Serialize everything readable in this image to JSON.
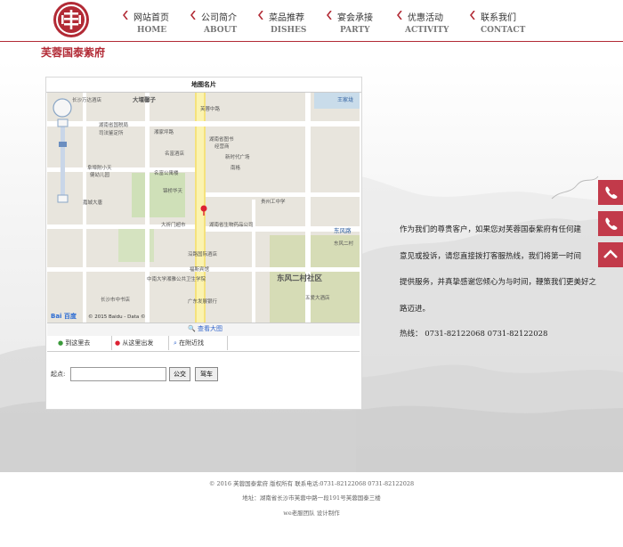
{
  "nav": {
    "items": [
      {
        "cn": "网站首页",
        "en": "HOME"
      },
      {
        "cn": "公司简介",
        "en": "ABOUT"
      },
      {
        "cn": "菜品推荐",
        "en": "DISHES"
      },
      {
        "cn": "宴会承接",
        "en": "PARTY"
      },
      {
        "cn": "优惠活动",
        "en": "ACTIVITY"
      },
      {
        "cn": "联系我们",
        "en": "CONTACT"
      }
    ]
  },
  "page": {
    "title": "芙蓉国泰紫府"
  },
  "map": {
    "header": "地图名片",
    "copyright": "© 2015 Baidu - Data ©",
    "big_map": "查看大图",
    "tabs": [
      "到这里去",
      "从这里出发",
      "在附近找"
    ],
    "start_label": "起点:",
    "bus_button": "公交",
    "drive_button": "驾车",
    "labels": {
      "l1": "长沙万达酒店",
      "l2": "湖南省国税局",
      "l3": "司法鉴定所",
      "l4": "湘家坪路",
      "l5": "名富酒店",
      "l6": "名富公寓楼",
      "l7": "新时代广场",
      "l8": "南格",
      "l9": "阜埠附小天",
      "l10": "健幼儿园",
      "l11": "湖南省图书",
      "l12": "经营商",
      "l13": "东风路",
      "l14": "东风二村",
      "l15": "东风二村社区",
      "l16": "五爱大酒店",
      "l17": "长沙市中",
      "l18": "湘西金德大厦",
      "l19": "大祈门超市",
      "l20": "湖南省生物药品公司",
      "l21": "沿路国际酒店",
      "l22": "福斯宾馆",
      "l23": "中南大学湘雅公共卫生学院",
      "l24": "广东发展银行",
      "l25": "长沙市中书店",
      "l26": "王家垅",
      "l27": "芙蓉中路",
      "l28": "大堰馨子",
      "l29": "中南大学",
      "l30": "公司局",
      "l31": "湘雅",
      "l32": "湖南省生物药品公司",
      "l33": "嘉城大唐",
      "l34": "锦桥华天",
      "l35": "芙蓉",
      "l36": "2号",
      "l37": "长沙市",
      "l38": "贵州工中学",
      "l39": "东风西村",
      "l40": "巨州风居",
      "l41": "长沙市人民",
      "l42": "惠",
      "l43": "华天宾馆",
      "l44": "湖南人民"
    }
  },
  "intro": {
    "lines": [
      "作为我们的尊贵客户，如果您对芙蓉国泰紫府有任何建",
      "意见或投诉，请您直接拨打客服热线，我们将第一时间",
      "提供服务，并真挚感谢您倾心为与时间，鞭策我们更美好之",
      "路迈进。"
    ],
    "hotline": "热线：  0731-82122068 0731-82122028"
  },
  "footer": {
    "line1": "© 2016 芙蓉国泰紫府 版权所有    联系电话:0731-82122068    0731-82122028",
    "line2": "地址：湖南省长沙市芙蓉中路一段191号芙蓉国泰三楼",
    "line3": "we老服团队 设计制作"
  },
  "colors": {
    "brand": "#b22a35",
    "side": "#c23a4a"
  }
}
